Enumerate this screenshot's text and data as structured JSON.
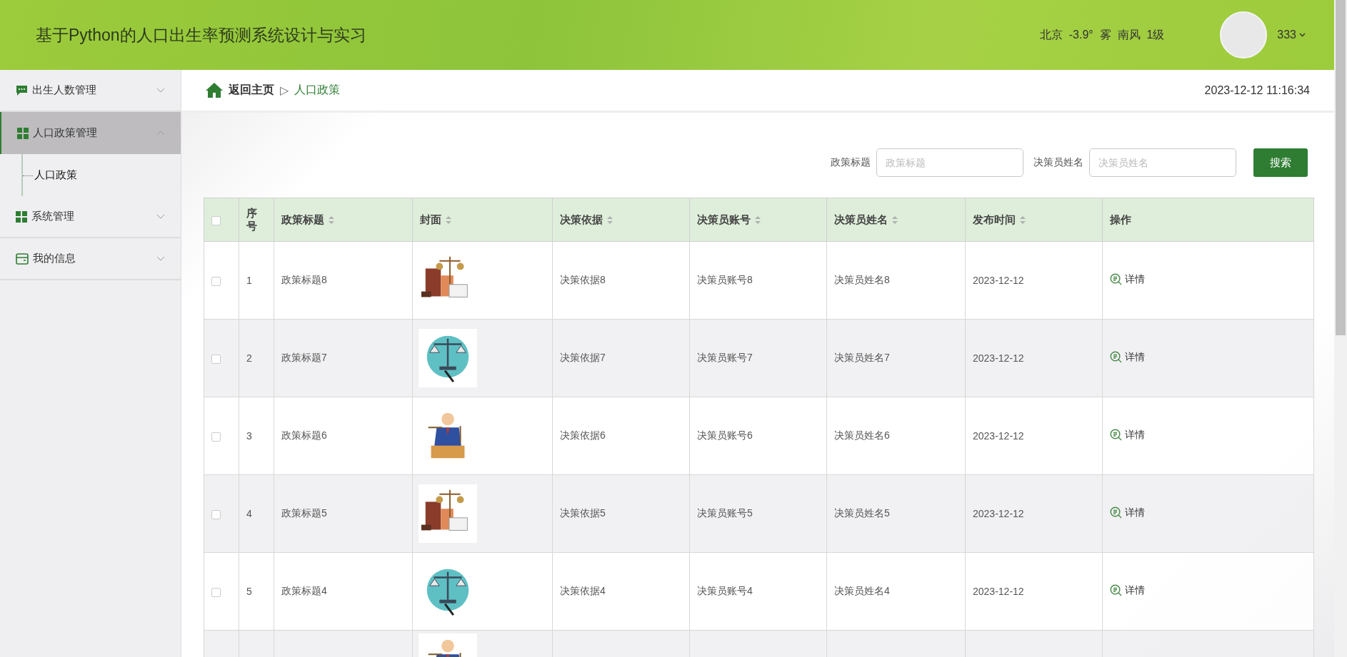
{
  "header": {
    "title": "基于Python的人口出生率预测系统设计与实习",
    "weather": "北京  -3.9°  雾  南风  1级",
    "user": "333"
  },
  "sidebar": {
    "items": [
      {
        "label": "出生人数管理",
        "expanded": false
      },
      {
        "label": "人口政策管理",
        "expanded": true,
        "children": [
          {
            "label": "人口政策",
            "selected": true
          }
        ]
      },
      {
        "label": "系统管理",
        "expanded": false
      },
      {
        "label": "我的信息",
        "expanded": false
      }
    ]
  },
  "breadcrumb": {
    "home": "返回主页",
    "separator": "▷",
    "current": "人口政策",
    "datetime": "2023-12-12 11:16:34"
  },
  "search": {
    "fields": [
      {
        "label": "政策标题",
        "placeholder": "政策标题"
      },
      {
        "label": "决策员姓名",
        "placeholder": "决策员姓名"
      }
    ],
    "button": "搜索"
  },
  "table": {
    "all_checked": false,
    "columns": [
      {
        "label": "序号",
        "sortable": false
      },
      {
        "label": "政策标题",
        "sortable": true
      },
      {
        "label": "封面",
        "sortable": true
      },
      {
        "label": "决策依据",
        "sortable": true
      },
      {
        "label": "决策员账号",
        "sortable": true
      },
      {
        "label": "决策员姓名",
        "sortable": true
      },
      {
        "label": "发布时间",
        "sortable": true
      },
      {
        "label": "操作",
        "sortable": false
      }
    ],
    "rows": [
      {
        "kind": "full",
        "checked": false,
        "index": "1",
        "title": "政策标题8",
        "basis": "决策依据8",
        "account": "决策员账号8",
        "name": "决策员姓名8",
        "date": "2023-12-12",
        "action": "详情"
      },
      {
        "kind": "full",
        "checked": false,
        "index": "2",
        "title": "政策标题7",
        "basis": "决策依据7",
        "account": "决策员账号7",
        "name": "决策员姓名7",
        "date": "2023-12-12",
        "action": "详情"
      },
      {
        "kind": "full",
        "checked": false,
        "index": "3",
        "title": "政策标题6",
        "basis": "决策依据6",
        "account": "决策员账号6",
        "name": "决策员姓名6",
        "date": "2023-12-12",
        "action": "详情"
      },
      {
        "kind": "full",
        "checked": false,
        "index": "4",
        "title": "政策标题5",
        "basis": "决策依据5",
        "account": "决策员账号5",
        "name": "决策员姓名5",
        "date": "2023-12-12",
        "action": "详情"
      },
      {
        "kind": "full",
        "checked": false,
        "index": "5",
        "title": "政策标题4",
        "basis": "决策依据4",
        "account": "决策员账号4",
        "name": "决策员姓名4",
        "date": "2023-12-12",
        "action": "详情"
      },
      {
        "kind": "partial"
      }
    ]
  }
}
